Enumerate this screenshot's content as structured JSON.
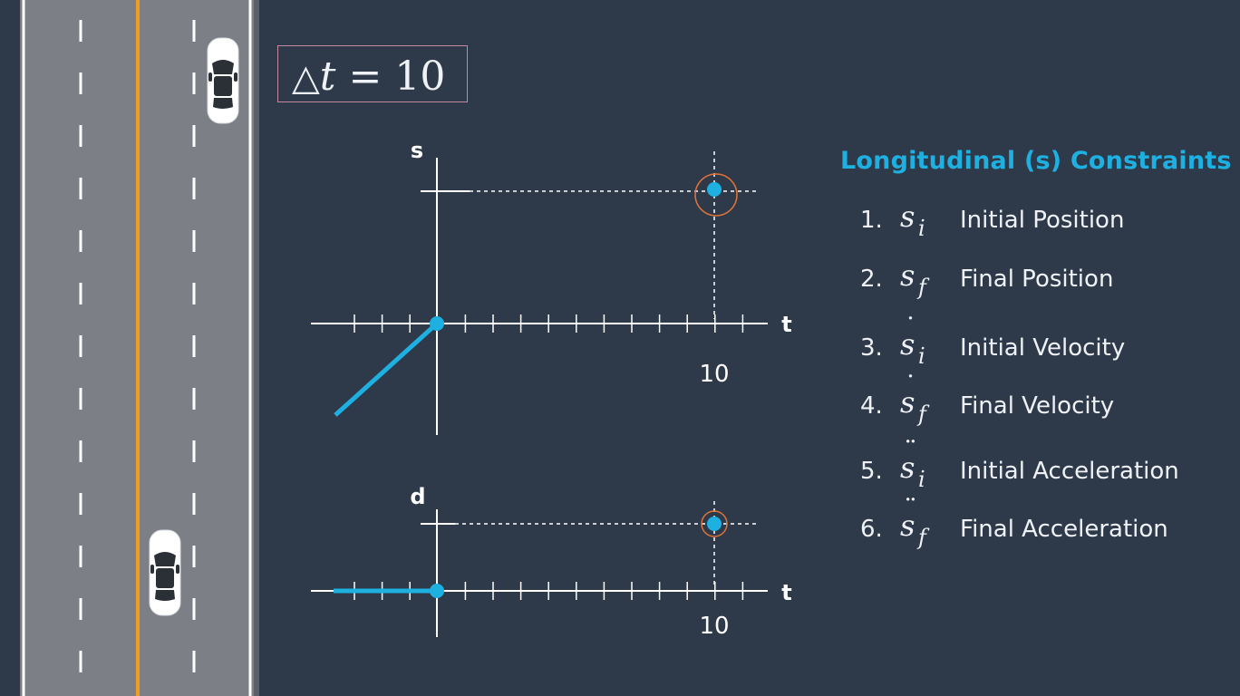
{
  "delta_t": {
    "symbol": "△",
    "variable": "t",
    "equals": "=",
    "value": "10"
  },
  "colors": {
    "background": "#2e3a49",
    "road": "#7c7f85",
    "lane_line": "#ffffff",
    "center_line": "#f39c23",
    "accent": "#1fb0e2",
    "highlight_ring": "#e0733a"
  },
  "road": {
    "cars": [
      {
        "name": "car-top",
        "lane": "right"
      },
      {
        "name": "car-bottom",
        "lane": "center"
      }
    ]
  },
  "s_plot": {
    "y_label": "s",
    "x_label": "t",
    "x_tick_label": "10",
    "start_point": {
      "t": 0,
      "value": 0
    },
    "end_point": {
      "t": 10,
      "value": 1
    },
    "history_slope": "rising"
  },
  "d_plot": {
    "y_label": "d",
    "x_label": "t",
    "x_tick_label": "10",
    "start_point": {
      "t": 0,
      "value": 0
    },
    "end_point": {
      "t": 10,
      "value": 1
    },
    "history_slope": "flat"
  },
  "constraints": {
    "title": "Longitudinal (s) Constraints",
    "items": [
      {
        "number": "1.",
        "base": "s",
        "dots": "",
        "sub": "i",
        "label": "Initial Position"
      },
      {
        "number": "2.",
        "base": "s",
        "dots": "",
        "sub": "f",
        "label": "Final Position"
      },
      {
        "number": "3.",
        "base": "s",
        "dots": "˙",
        "sub": "i",
        "label": "Initial Velocity"
      },
      {
        "number": "4.",
        "base": "s",
        "dots": "˙",
        "sub": "f",
        "label": "Final Velocity"
      },
      {
        "number": "5.",
        "base": "s",
        "dots": "¨",
        "sub": "i",
        "label": "Initial Acceleration"
      },
      {
        "number": "6.",
        "base": "s",
        "dots": "¨",
        "sub": "f",
        "label": "Final Acceleration"
      }
    ]
  }
}
